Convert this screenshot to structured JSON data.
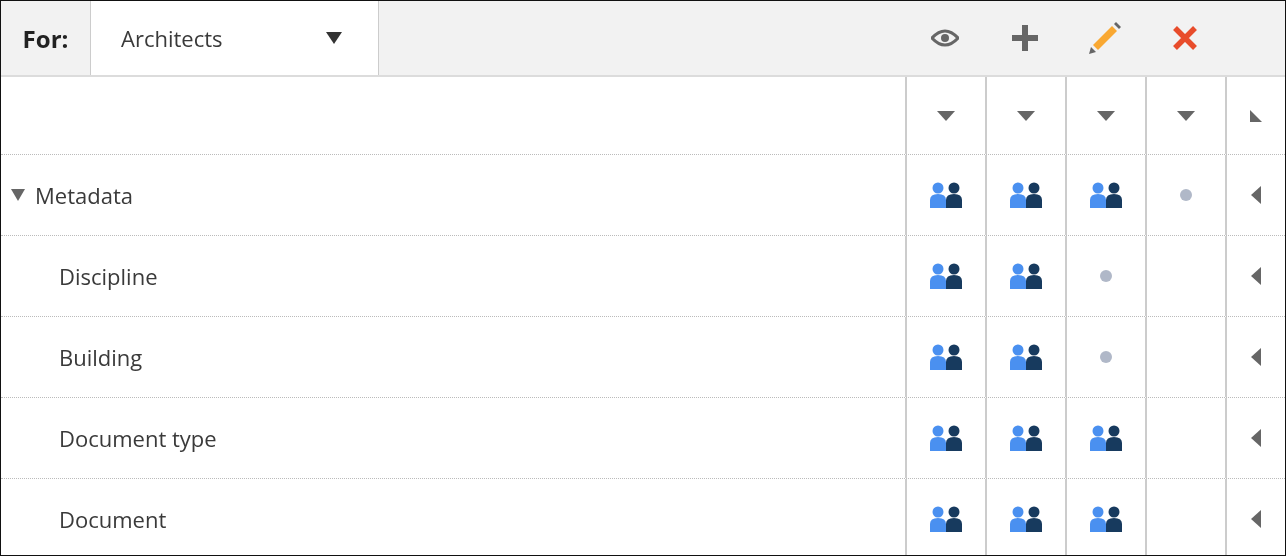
{
  "toolbar": {
    "label": "For:",
    "role_dropdown": {
      "value": "Architects"
    },
    "actions": [
      {
        "kind": "view"
      },
      {
        "kind": "add"
      },
      {
        "kind": "edit"
      },
      {
        "kind": "delete"
      }
    ]
  },
  "table": {
    "rows": [
      {
        "name": "Metadata",
        "expanded": true,
        "cells": [
          {
            "kind": "group"
          },
          {
            "kind": "group"
          },
          {
            "kind": "group"
          },
          {
            "kind": "dot"
          }
        ],
        "children": [
          {
            "name": "Discipline",
            "cells": [
              {
                "kind": "group"
              },
              {
                "kind": "group"
              },
              {
                "kind": "dot"
              },
              {
                "kind": "empty"
              }
            ]
          },
          {
            "name": "Building",
            "cells": [
              {
                "kind": "group"
              },
              {
                "kind": "group"
              },
              {
                "kind": "dot"
              },
              {
                "kind": "empty"
              }
            ]
          },
          {
            "name": "Document type",
            "cells": [
              {
                "kind": "group"
              },
              {
                "kind": "group"
              },
              {
                "kind": "group"
              },
              {
                "kind": "empty"
              }
            ]
          },
          {
            "name": "Document",
            "cells": [
              {
                "kind": "group"
              },
              {
                "kind": "group"
              },
              {
                "kind": "group"
              },
              {
                "kind": "empty"
              }
            ]
          }
        ]
      }
    ]
  }
}
